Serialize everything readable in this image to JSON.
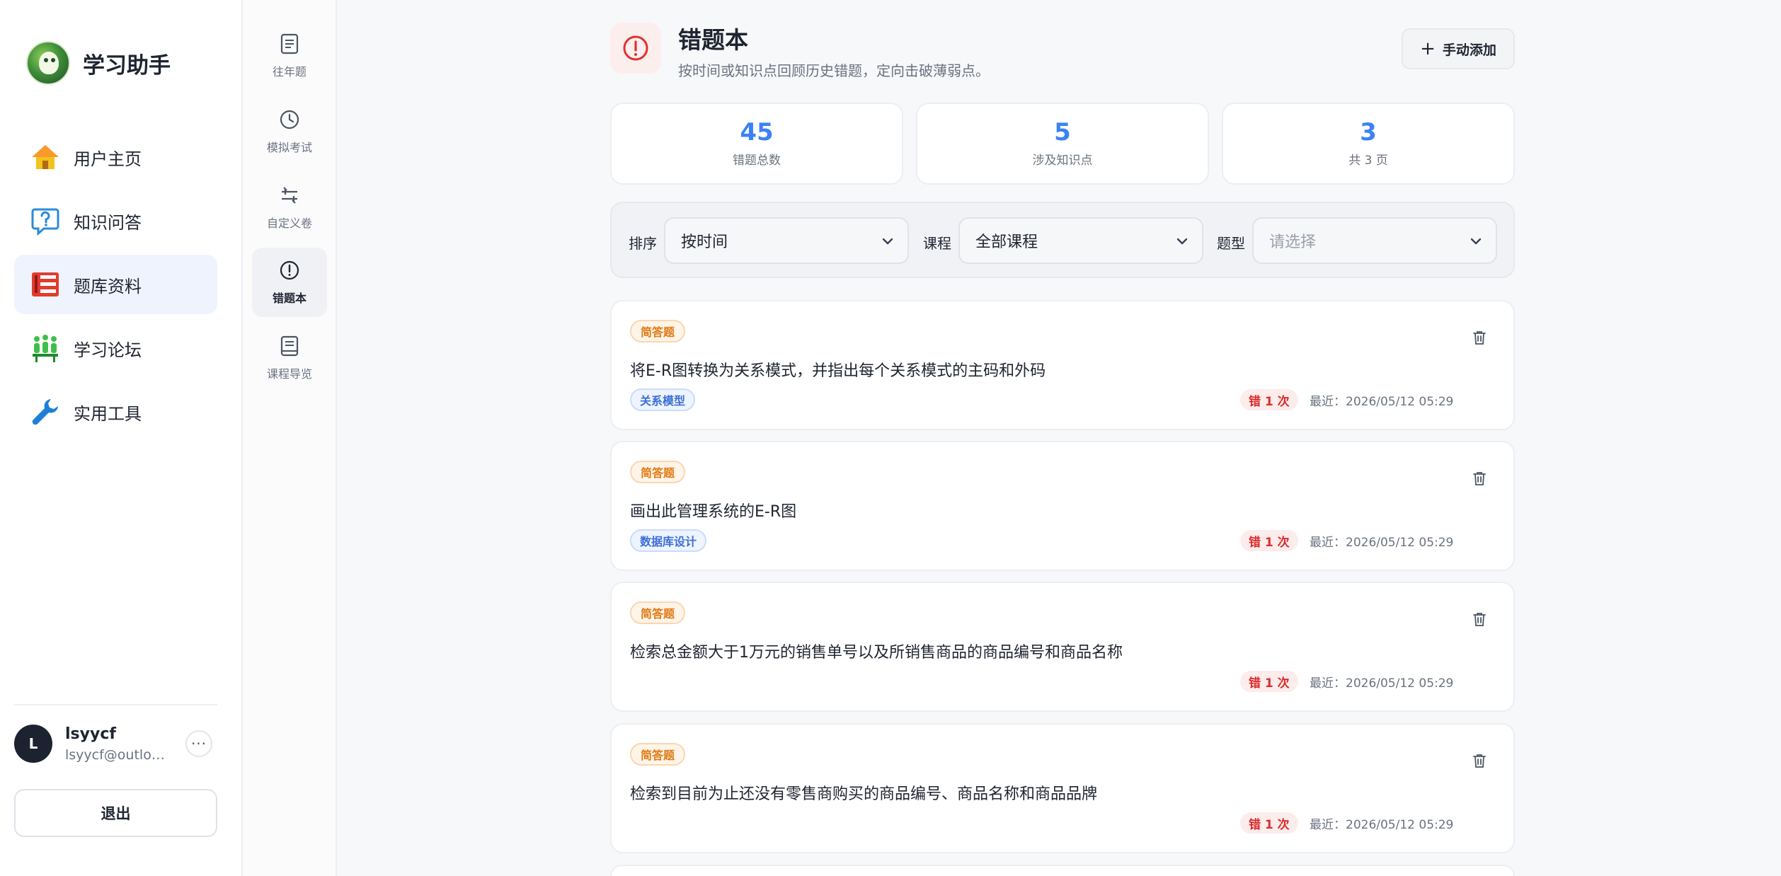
{
  "brand": {
    "title": "学习助手"
  },
  "nav": {
    "items": [
      {
        "label": "用户主页",
        "icon": "home-icon"
      },
      {
        "label": "知识问答",
        "icon": "question-chat-icon"
      },
      {
        "label": "题库资料",
        "icon": "question-bank-icon",
        "active": true
      },
      {
        "label": "学习论坛",
        "icon": "forum-icon"
      },
      {
        "label": "实用工具",
        "icon": "wrench-icon"
      }
    ]
  },
  "user": {
    "initial": "L",
    "name": "lsyycf",
    "email": "lsyycf@outloo···",
    "more": "···"
  },
  "logout_label": "退出",
  "subnav": {
    "items": [
      {
        "label": "往年题",
        "icon": "document-icon"
      },
      {
        "label": "模拟考试",
        "icon": "clock-icon"
      },
      {
        "label": "自定义卷",
        "icon": "custom-paper-icon"
      },
      {
        "label": "错题本",
        "icon": "alert-circle-icon",
        "active": true
      },
      {
        "label": "课程导览",
        "icon": "book-icon"
      }
    ]
  },
  "header": {
    "title": "错题本",
    "subtitle": "按时间或知识点回顾历史错题，定向击破薄弱点。",
    "add_label": "手动添加"
  },
  "stats": [
    {
      "value": "45",
      "label": "错题总数"
    },
    {
      "value": "5",
      "label": "涉及知识点"
    },
    {
      "value": "3",
      "label": "共 3 页"
    }
  ],
  "filters": {
    "sort_label": "排序",
    "sort_value": "按时间",
    "course_label": "课程",
    "course_value": "全部课程",
    "type_label": "题型",
    "type_placeholder": "请选择"
  },
  "questions": [
    {
      "type": "简答题",
      "text": "将E-R图转换为关系模式，并指出每个关系模式的主码和外码",
      "topic": "关系模型",
      "wrong": "错 1 次",
      "recent": "最近：2026/05/12 05:29"
    },
    {
      "type": "简答题",
      "text": "画出此管理系统的E-R图",
      "topic": "数据库设计",
      "wrong": "错 1 次",
      "recent": "最近：2026/05/12 05:29"
    },
    {
      "type": "简答题",
      "text": "检索总金额大于1万元的销售单号以及所销售商品的商品编号和商品名称",
      "topic": "",
      "wrong": "错 1 次",
      "recent": "最近：2026/05/12 05:29"
    },
    {
      "type": "简答题",
      "text": "检索到目前为止还没有零售商购买的商品编号、商品名称和商品品牌",
      "topic": "",
      "wrong": "错 1 次",
      "recent": "最近：2026/05/12 05:29"
    }
  ],
  "colors": {
    "accent": "#3b82f6",
    "danger": "#d92d2d",
    "warning": "#e07a14"
  }
}
